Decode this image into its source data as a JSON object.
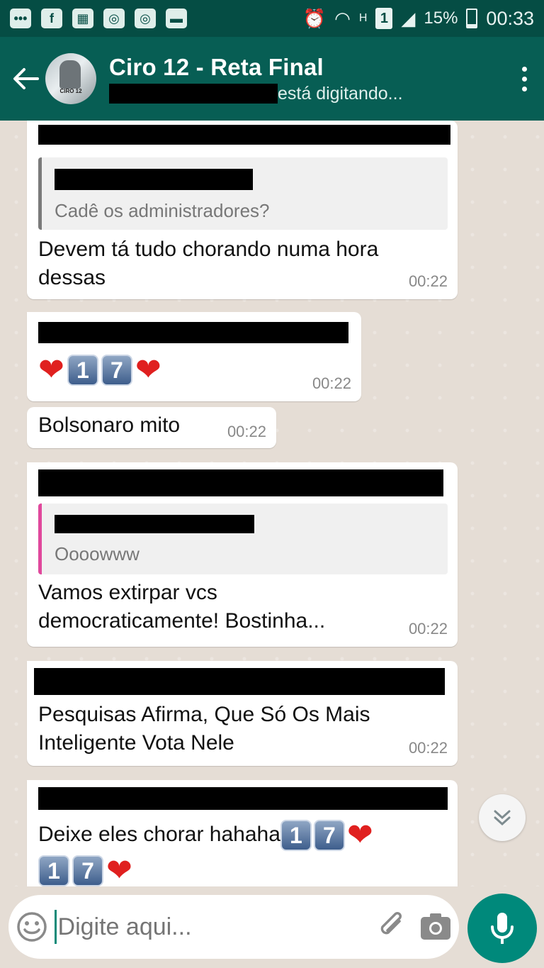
{
  "status_bar": {
    "fb_icon": "f",
    "network_type": "H",
    "sim_slot": "1",
    "battery": "15%",
    "time": "00:33"
  },
  "header": {
    "title": "Ciro 12 - Reta Final",
    "avatar_text": "CIRO 12",
    "typing_text": "está digitando..."
  },
  "messages": [
    {
      "quote_text": "Cadê os administradores?",
      "text": "Devem tá tudo chorando numa hora\ndessas",
      "time": "00:22"
    },
    {
      "digits": [
        "1",
        "7"
      ],
      "time": "00:22"
    },
    {
      "text": "Bolsonaro mito",
      "time": "00:22"
    },
    {
      "quote_text": "Oooowww",
      "quote_color": "#e0489c",
      "text": "Vamos extirpar vcs\ndemocraticamente! Bostinha...",
      "time": "00:22"
    },
    {
      "text": "Pesquisas Afirma, Que Só Os Mais\nInteligente Vota Nele",
      "time": "00:22"
    },
    {
      "text": "Deixe eles chorar hahaha",
      "digits": [
        "1",
        "7"
      ]
    }
  ],
  "input": {
    "placeholder": "Digite aqui..."
  },
  "colors": {
    "status_bar": "#054d44",
    "header": "#075e54",
    "accent": "#00897b",
    "chat_bg": "#e5ddd5"
  },
  "icons": [
    "back-arrow-icon",
    "more-vert-icon",
    "smiley-icon",
    "paperclip-icon",
    "camera-icon",
    "mic-icon",
    "chevron-down-icon"
  ]
}
